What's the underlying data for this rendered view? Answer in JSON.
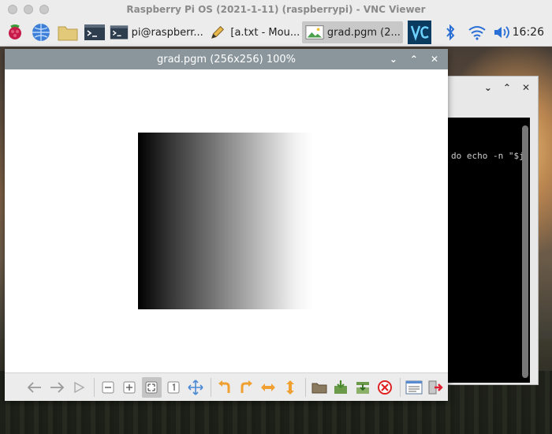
{
  "mac": {
    "title": "Raspberry Pi OS (2021-1-11) (raspberrypi) - VNC Viewer"
  },
  "taskbar": {
    "tasks": [
      {
        "label": "pi@raspberr..."
      },
      {
        "label": "[a.txt - Mou..."
      },
      {
        "label": "grad.pgm (2..."
      }
    ],
    "clock": "16:26"
  },
  "terminal": {
    "text": "do echo -n \"$j"
  },
  "viewer": {
    "title": "grad.pgm (256x256) 100%",
    "toolbar_icons": [
      "back-arrow-icon",
      "forward-arrow-icon",
      "play-icon",
      "zoom-out-icon",
      "zoom-in-icon",
      "fit-window-icon",
      "original-size-icon",
      "fullscreen-icon",
      "rotate-left-icon",
      "rotate-right-icon",
      "flip-horizontal-icon",
      "flip-vertical-icon",
      "open-file-icon",
      "save-file-icon",
      "save-as-icon",
      "delete-icon",
      "preferences-icon",
      "quit-icon"
    ]
  }
}
